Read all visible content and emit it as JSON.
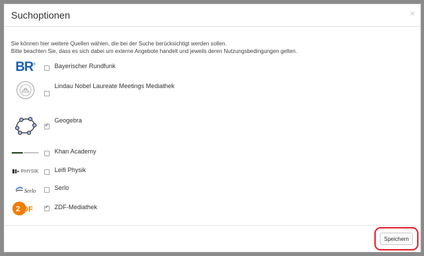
{
  "dialog": {
    "title": "Suchoptionen",
    "close_glyph": "×",
    "intro_line1": "Sie können hier weitere Quellen wählen, die bei der Suche berücksichtigt werden sollen.",
    "intro_line2": "Bitte beachten Sie, dass es sich dabei um externe Angebote handelt und jeweils deren Nutzungsbedingungen gelten.",
    "options": [
      {
        "label": "Bayerischer Rundfunk",
        "checked": false,
        "logo_icon": "br-logo-icon",
        "logo_text": "BR"
      },
      {
        "label": "Lindau Nobel Laureate Meetings Mediathek",
        "checked": false,
        "logo_icon": "lindau-seal-icon"
      },
      {
        "label": "Geogebra",
        "checked": true,
        "logo_icon": "geogebra-logo-icon"
      },
      {
        "label": "Khan Academy",
        "checked": false,
        "logo_icon": "khan-academy-logo-icon"
      },
      {
        "label": "Leifi Physik",
        "checked": false,
        "logo_icon": "leifi-physik-logo-icon",
        "logo_text": "PHYSIK"
      },
      {
        "label": "Serlo",
        "checked": false,
        "logo_icon": "serlo-logo-icon",
        "logo_text": "Serlo"
      },
      {
        "label": "ZDF-Mediathek",
        "checked": true,
        "logo_icon": "zdf-logo-icon",
        "logo_text": "ZDF"
      }
    ],
    "save_label": "Speichern"
  },
  "colors": {
    "highlight": "#e0212f",
    "br_blue": "#1a5fb0",
    "zdf_orange": "#f07d00",
    "geogebra_blue": "#2b3b8c"
  }
}
